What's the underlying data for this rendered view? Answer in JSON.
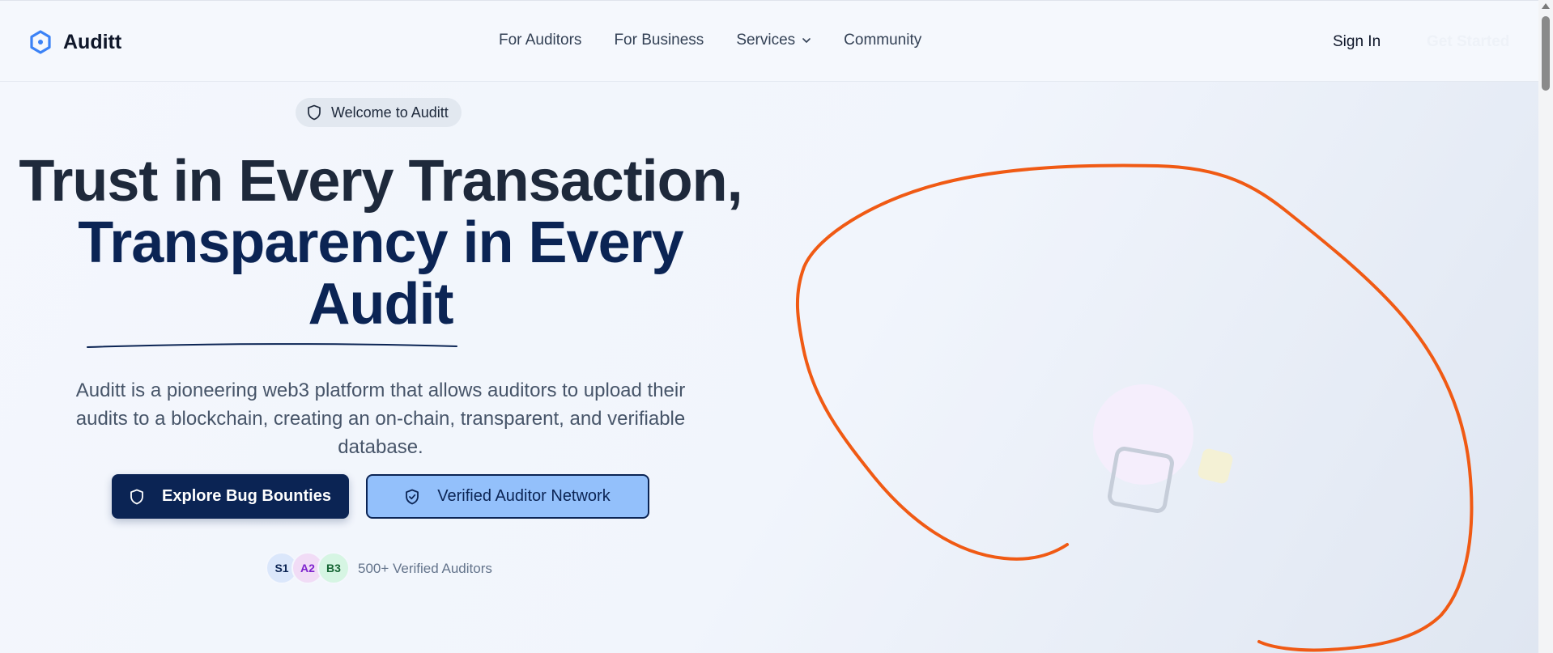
{
  "brand": {
    "name": "Auditt"
  },
  "nav": {
    "links": [
      {
        "label": "For Auditors"
      },
      {
        "label": "For Business"
      },
      {
        "label": "Services"
      },
      {
        "label": "Community"
      }
    ],
    "sign_in": "Sign In",
    "get_started": "Get Started"
  },
  "hero": {
    "badge": "Welcome to Auditt",
    "headline_line1": "Trust in Every Transaction,",
    "headline_line2": "Transparency in Every",
    "headline_line3": "Audit",
    "subtitle": "Auditt is a pioneering web3 platform that allows auditors to upload their audits to a blockchain, creating an on-chain, transparent, and verifiable database.",
    "primary_button": "Explore Bug Bounties",
    "secondary_button": "Verified Auditor Network",
    "avatars": [
      "S1",
      "A2",
      "B3"
    ],
    "auditors_text": "500+ Verified Auditors"
  },
  "icons": {
    "brand": "hexagon-logo-icon",
    "badge": "shield-icon",
    "primary_button": "shield-icon",
    "secondary_button": "shield-check-icon",
    "services_dropdown": "chevron-down-icon"
  },
  "colors": {
    "primary": "#0b2454",
    "secondary_button_bg": "#93c0fb",
    "brand_icon": "#3b82f6",
    "annotation": "#f05a14"
  }
}
